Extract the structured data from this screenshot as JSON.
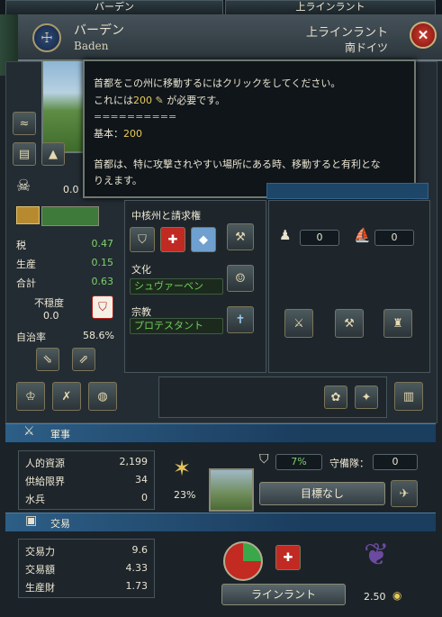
{
  "tabs": {
    "left": "バーデン",
    "right": "上ラインラント"
  },
  "header": {
    "province_name": "バーデン",
    "province_sub": "Baden",
    "area_name": "上ラインラント",
    "region_name": "南ドイツ"
  },
  "tooltip": {
    "line1": "首都をこの州に移動するにはクリックをしてください。",
    "line2_prefix": "これには",
    "line2_cost": "200",
    "line2_suffix": "が必要です。",
    "divider": "==========",
    "base_label": "基本：",
    "base_value": "200",
    "desc1": "首都は、特に攻撃されやすい場所にある時、移動すると有利とな",
    "desc2": "りえます。"
  },
  "stats": {
    "top_value": "0.0",
    "tax_label": "税",
    "tax_value": "0.47",
    "production_label": "生産",
    "production_value": "0.15",
    "total_label": "合計",
    "total_value": "0.63",
    "unrest_label": "不穏度",
    "unrest_value": "0.0",
    "autonomy_label": "自治率",
    "autonomy_value": "58.6%"
  },
  "core": {
    "title": "中核州と請求権"
  },
  "culture": {
    "title": "文化",
    "value": "シュヴァーベン"
  },
  "religion": {
    "title": "宗教",
    "value": "プロテスタント"
  },
  "counters": {
    "left": "0",
    "right": "0"
  },
  "military": {
    "title": "軍事",
    "manpower_label": "人的資源",
    "manpower_value": "2,199",
    "supply_label": "供給限界",
    "supply_value": "34",
    "sailors_label": "水兵",
    "sailors_value": "0",
    "percent": "23%",
    "fort_percent": "7%",
    "garrison_label": "守備隊：",
    "garrison_value": "0",
    "target_button": "目標なし"
  },
  "trade": {
    "title": "交易",
    "power_label": "交易力",
    "power_value": "9.6",
    "value_label": "交易額",
    "value_value": "4.33",
    "goods_label": "生産財",
    "goods_value": "1.73",
    "node_button": "ラインラント",
    "goods_price": "2.50"
  },
  "colors": {
    "accent_green": "#7fd36a",
    "gold": "#e8c95a",
    "section_blue": "#2d5e86"
  }
}
